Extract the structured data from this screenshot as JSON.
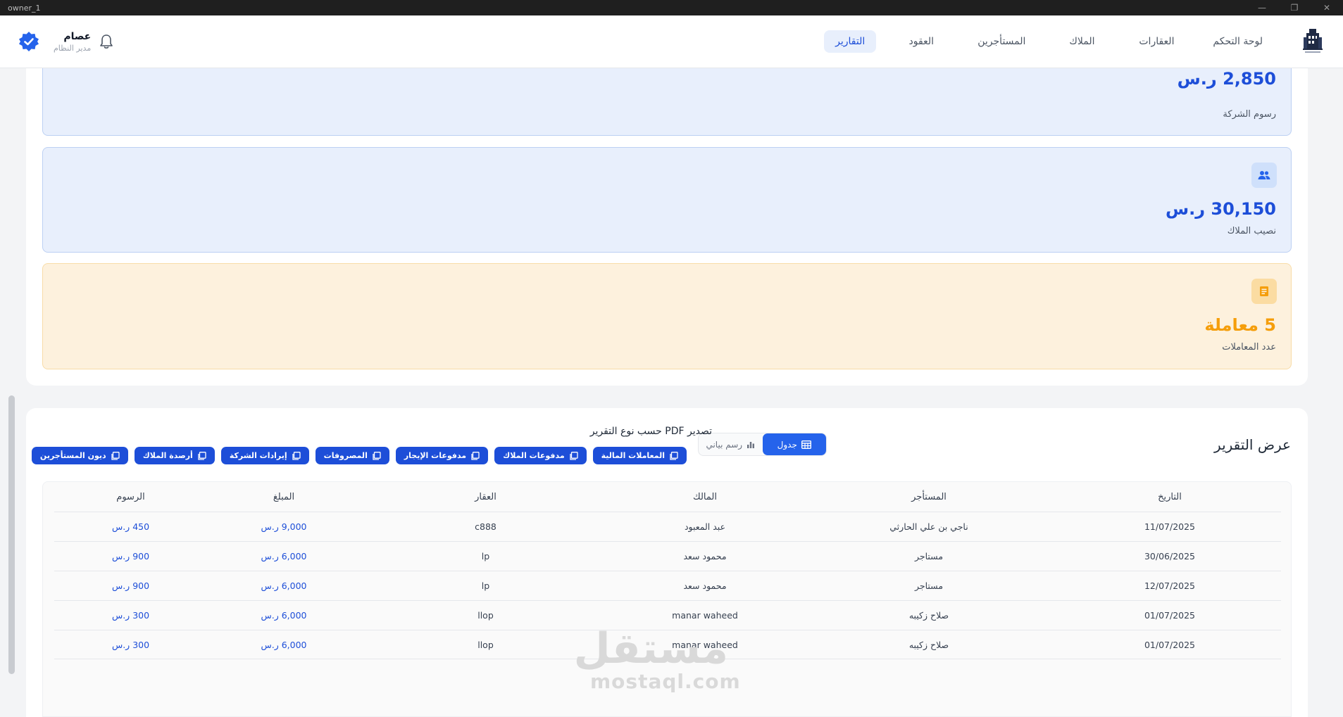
{
  "window": {
    "title": "owner_1"
  },
  "header": {
    "nav": [
      {
        "label": "لوحة التحكم",
        "active": false
      },
      {
        "label": "العقارات",
        "active": false
      },
      {
        "label": "الملاك",
        "active": false
      },
      {
        "label": "المستأجرين",
        "active": false
      },
      {
        "label": "العقود",
        "active": false
      },
      {
        "label": "التقارير",
        "active": true
      }
    ],
    "user": {
      "name": "عصام",
      "role": "مدير النظام"
    }
  },
  "summary_cards": [
    {
      "value": "2,850 ر.س",
      "label": "رسوم الشركة",
      "color": "blue",
      "icon": ""
    },
    {
      "value": "30,150 ر.س",
      "label": "نصيب الملاك",
      "color": "blue",
      "icon": "users-icon"
    },
    {
      "value": "5 معاملة",
      "label": "عدد المعاملات",
      "color": "orange",
      "icon": "receipt-icon"
    }
  ],
  "report": {
    "title": "عرض التقرير",
    "view_toggle": {
      "table_label": "جدول",
      "chart_label": "رسم بياني",
      "selected": "table"
    },
    "export_title": "تصدير PDF حسب نوع التقرير",
    "export_buttons": [
      "المعاملات المالية",
      "مدفوعات الملاك",
      "مدفوعات الإيجار",
      "المصروفات",
      "إيرادات الشركة",
      "أرصدة الملاك",
      "ديون المستأجرين"
    ],
    "table": {
      "columns": [
        "التاريخ",
        "المستأجر",
        "المالك",
        "العقار",
        "المبلغ",
        "الرسوم"
      ],
      "rows": [
        [
          "11/07/2025",
          "ناجي بن علي الحارثي",
          "عبد المعبود",
          "c888",
          "9,000 ر.س",
          "450 ر.س"
        ],
        [
          "30/06/2025",
          "مستاجر",
          "محمود سعد",
          "lp",
          "6,000 ر.س",
          "900 ر.س"
        ],
        [
          "12/07/2025",
          "مستاجر",
          "محمود سعد",
          "lp",
          "6,000 ر.س",
          "900 ر.س"
        ],
        [
          "01/07/2025",
          "صلاح زكيبه",
          "manar waheed",
          "llop",
          "6,000 ر.س",
          "300 ر.س"
        ],
        [
          "01/07/2025",
          "صلاح زكيبه",
          "manar waheed",
          "llop",
          "6,000 ر.س",
          "300 ر.س"
        ]
      ]
    }
  },
  "watermark": {
    "arabic": "مستقل",
    "latin": "mostaql.com"
  },
  "colors": {
    "primary": "#1d4ed8",
    "card_blue": "#e8effc",
    "card_orange": "#fdf1dd",
    "accent_orange": "#f59e0b"
  }
}
